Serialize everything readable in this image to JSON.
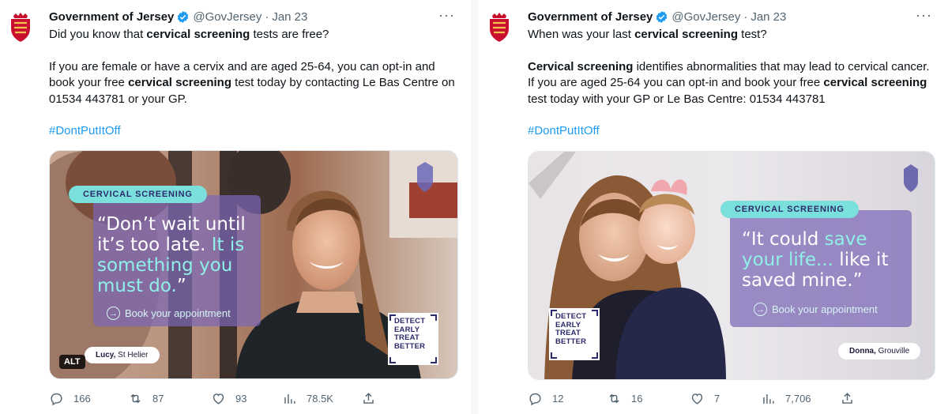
{
  "tweets": [
    {
      "account_name": "Government of Jersey",
      "handle": "@GovJersey",
      "separator": "·",
      "date": "Jan 23",
      "more": "···",
      "body": [
        [
          {
            "t": "Did you know that ",
            "b": false
          },
          {
            "t": "cervical screening",
            "b": true
          },
          {
            "t": " tests are free?",
            "b": false
          }
        ],
        [
          {
            "t": "If you are female or have a cervix and are aged 25-64, you can opt-in and book your free ",
            "b": false
          },
          {
            "t": "cervical screening",
            "b": true
          },
          {
            "t": " test today by contacting Le Bas Centre on 01534 443781 or your GP.",
            "b": false
          }
        ]
      ],
      "hashtag": "#DontPutItOff",
      "image": {
        "pill": "CERVICAL SCREENING",
        "quote_parts": [
          {
            "t": "“Don’t wait until it’s too late. ",
            "hl": false
          },
          {
            "t": "It is something you must do.",
            "hl": true
          },
          {
            "t": "”",
            "hl": false
          }
        ],
        "book": "Book your appointment",
        "person_name": "Lucy,",
        "person_place": "St Helier",
        "logo_lines": [
          "DETECT",
          "EARLY",
          "TREAT",
          "BETTER"
        ],
        "alt": "ALT"
      },
      "stats": {
        "replies": "166",
        "retweets": "87",
        "likes": "93",
        "views": "78.5K"
      }
    },
    {
      "account_name": "Government of Jersey",
      "handle": "@GovJersey",
      "separator": "·",
      "date": "Jan 23",
      "more": "···",
      "body": [
        [
          {
            "t": "When was your last ",
            "b": false
          },
          {
            "t": "cervical screening",
            "b": true
          },
          {
            "t": " test?",
            "b": false
          }
        ],
        [
          {
            "t": "Cervical screening",
            "b": true
          },
          {
            "t": " identifies abnormalities that may lead to cervical cancer. If you are aged 25-64 you can opt-in and book your free ",
            "b": false
          },
          {
            "t": "cervical screening",
            "b": true
          },
          {
            "t": " test today with your GP or Le Bas Centre: 01534 443781",
            "b": false
          }
        ]
      ],
      "hashtag": "#DontPutItOff",
      "image": {
        "pill": "CERVICAL SCREENING",
        "quote_parts": [
          {
            "t": "“It could ",
            "hl": false
          },
          {
            "t": "save your life...",
            "hl": true
          },
          {
            "t": " like it saved mine.”",
            "hl": false
          }
        ],
        "book": "Book your appointment",
        "person_name": "Donna,",
        "person_place": "Grouville",
        "logo_lines": [
          "DETECT",
          "EARLY",
          "TREAT",
          "BETTER"
        ]
      },
      "stats": {
        "replies": "12",
        "retweets": "16",
        "likes": "7",
        "views": "7,706"
      }
    }
  ],
  "colors": {
    "brand_red": "#c8102e",
    "verified_blue": "#1d9bf0",
    "link_blue": "#1d9bf0",
    "muted_text": "#536471",
    "pill_teal": "#7be0dc",
    "quote_highlight": "#8ff0e8",
    "quote_box_purple": "#7c66b5"
  },
  "icons": [
    "jersey-crest-icon",
    "verified-badge-icon",
    "more-icon",
    "reply-icon",
    "retweet-icon",
    "like-icon",
    "views-icon",
    "share-icon"
  ]
}
